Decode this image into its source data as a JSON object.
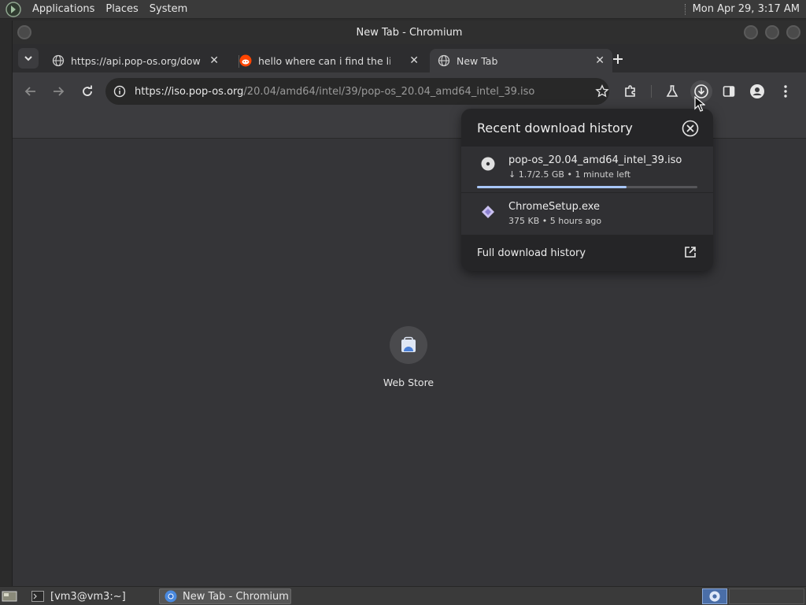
{
  "top_panel": {
    "menus": [
      "Applications",
      "Places",
      "System"
    ],
    "clock": "Mon Apr 29,  3:17 AM"
  },
  "window": {
    "title": "New Tab - Chromium"
  },
  "tabs": [
    {
      "label": "https://api.pop-os.org/downlo",
      "favicon": "globe-icon"
    },
    {
      "label": "hello where can i find the link",
      "favicon": "reddit-icon"
    },
    {
      "label": "New Tab",
      "favicon": "globe-icon",
      "active": true
    }
  ],
  "toolbar": {
    "url_host": "https://iso.pop-os.org",
    "url_path": "/20.04/amd64/intel/39/pop-os_20.04_amd64_intel_39.iso"
  },
  "shortcut": {
    "label": "Web Store"
  },
  "downloads": {
    "title": "Recent download history",
    "items": [
      {
        "name": "pop-os_20.04_amd64_intel_39.iso",
        "meta": "↓ 1.7/2.5 GB • 1 minute left",
        "progress": 0.68,
        "icon": "disc-icon"
      },
      {
        "name": "ChromeSetup.exe",
        "meta": "375 KB • 5 hours ago",
        "icon": "exe-icon"
      }
    ],
    "footer": "Full download history"
  },
  "bottom_panel": {
    "tasks": [
      "[vm3@vm3:~]",
      "New Tab - Chromium"
    ]
  },
  "colors": {
    "accent": "#a8c7fa",
    "bg": "#353538"
  }
}
